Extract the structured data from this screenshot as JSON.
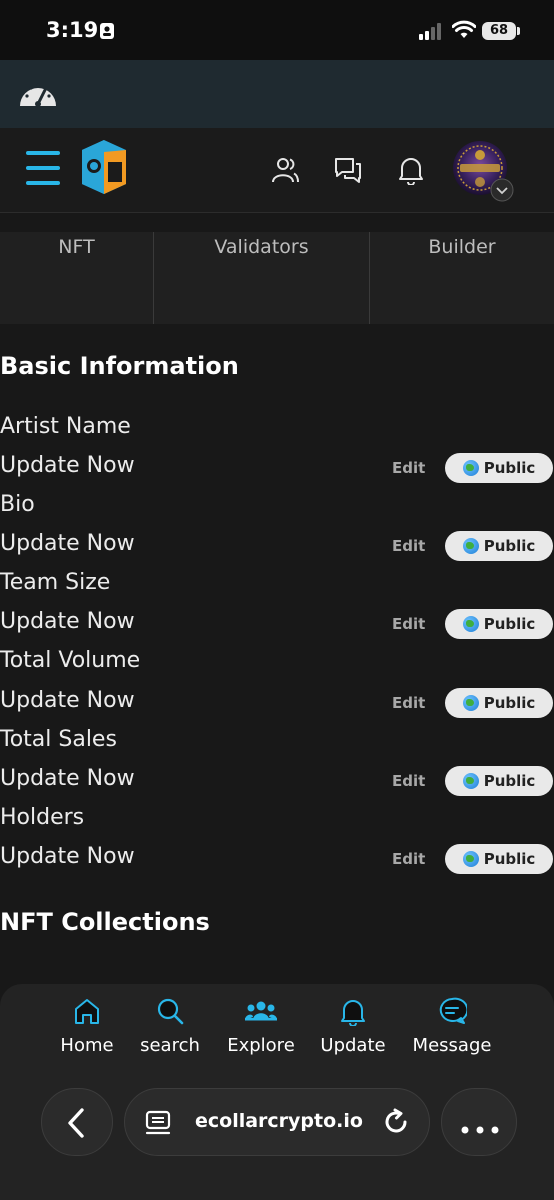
{
  "status_bar": {
    "time": "3:19",
    "battery": "68"
  },
  "tabs": [
    {
      "label": "NFT"
    },
    {
      "label": "Validators"
    },
    {
      "label": "Builder"
    }
  ],
  "basic_info": {
    "title": "Basic Information",
    "fields": [
      {
        "label": "Artist Name",
        "value": "Update Now",
        "edit": "Edit",
        "visibility": "Public"
      },
      {
        "label": "Bio",
        "value": "Update Now",
        "edit": "Edit",
        "visibility": "Public"
      },
      {
        "label": "Team Size",
        "value": "Update Now",
        "edit": "Edit",
        "visibility": "Public"
      },
      {
        "label": "Total Volume",
        "value": "Update Now",
        "edit": "Edit",
        "visibility": "Public"
      },
      {
        "label": "Total Sales",
        "value": "Update Now",
        "edit": "Edit",
        "visibility": "Public"
      },
      {
        "label": "Holders",
        "value": "Update Now",
        "edit": "Edit",
        "visibility": "Public"
      }
    ]
  },
  "collections": {
    "title": "NFT Collections"
  },
  "bottom_nav": [
    {
      "label": "Home",
      "icon": "home-icon"
    },
    {
      "label": "search",
      "icon": "search-icon"
    },
    {
      "label": "Explore",
      "icon": "users-icon"
    },
    {
      "label": "Update",
      "icon": "bell-icon"
    },
    {
      "label": "Message",
      "icon": "message-icon"
    }
  ],
  "browser": {
    "url": "ecollarcrypto.io"
  },
  "colors": {
    "accent": "#29b6e8",
    "logo_orange": "#f29a22",
    "logo_blue": "#2aa6d8"
  }
}
